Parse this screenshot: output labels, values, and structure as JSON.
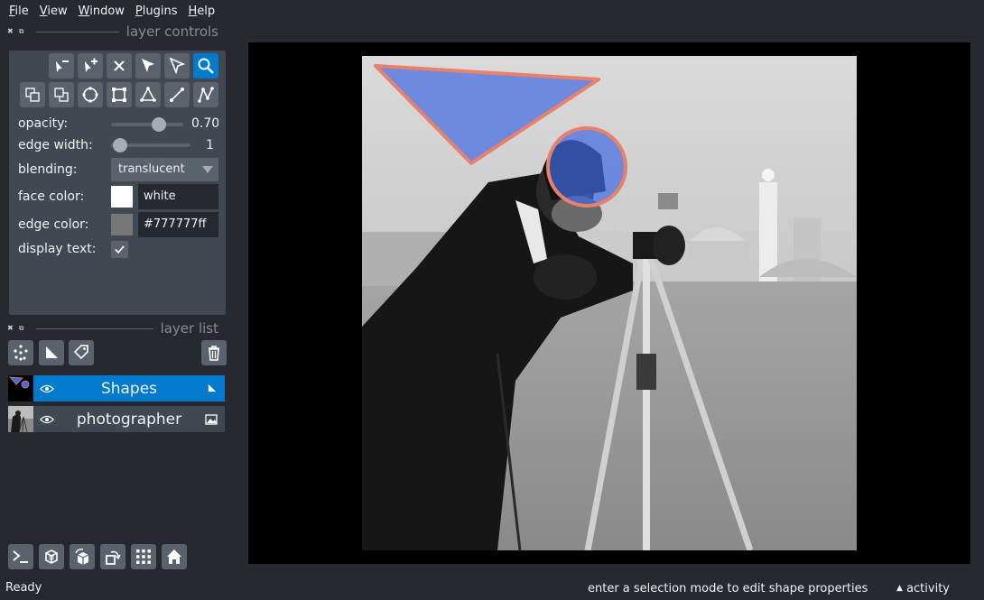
{
  "menu": {
    "file": {
      "u": "F",
      "rest": "ile"
    },
    "view": {
      "u": "V",
      "rest": "iew"
    },
    "window": {
      "u": "W",
      "rest": "indow"
    },
    "plugins": {
      "u": "P",
      "rest": "lugins"
    },
    "help": {
      "u": "H",
      "rest": "elp"
    }
  },
  "layer_controls": {
    "title": "layer controls",
    "opacity": {
      "label": "opacity:",
      "value": "0.70",
      "level": 0.7
    },
    "edge_width": {
      "label": "edge width:",
      "value": "1",
      "level": 0.0
    },
    "blending": {
      "label": "blending:",
      "value": "translucent"
    },
    "face_color": {
      "label": "face color:",
      "value": "white",
      "swatch": "#ffffff"
    },
    "edge_color": {
      "label": "edge color:",
      "value": "#777777ff",
      "swatch": "#777777"
    },
    "display_text": {
      "label": "display text:",
      "checked": true
    },
    "active_tool": "zoom-icon"
  },
  "layer_list": {
    "title": "layer list",
    "layers": [
      {
        "name": "Shapes",
        "selected": true,
        "visible": true,
        "type_icon": "shapes-layer-icon"
      },
      {
        "name": "photographer",
        "selected": false,
        "visible": true,
        "type_icon": "image-layer-icon"
      }
    ]
  },
  "status": {
    "left": "Ready",
    "right": "enter a selection mode to edit shape properties",
    "activity": "activity"
  },
  "colors": {
    "accent": "#007acc",
    "background": "#262930",
    "panel": "#414851",
    "button": "#5a626c",
    "shape_face": "#4169e1",
    "shape_edge": "#e9806a"
  }
}
